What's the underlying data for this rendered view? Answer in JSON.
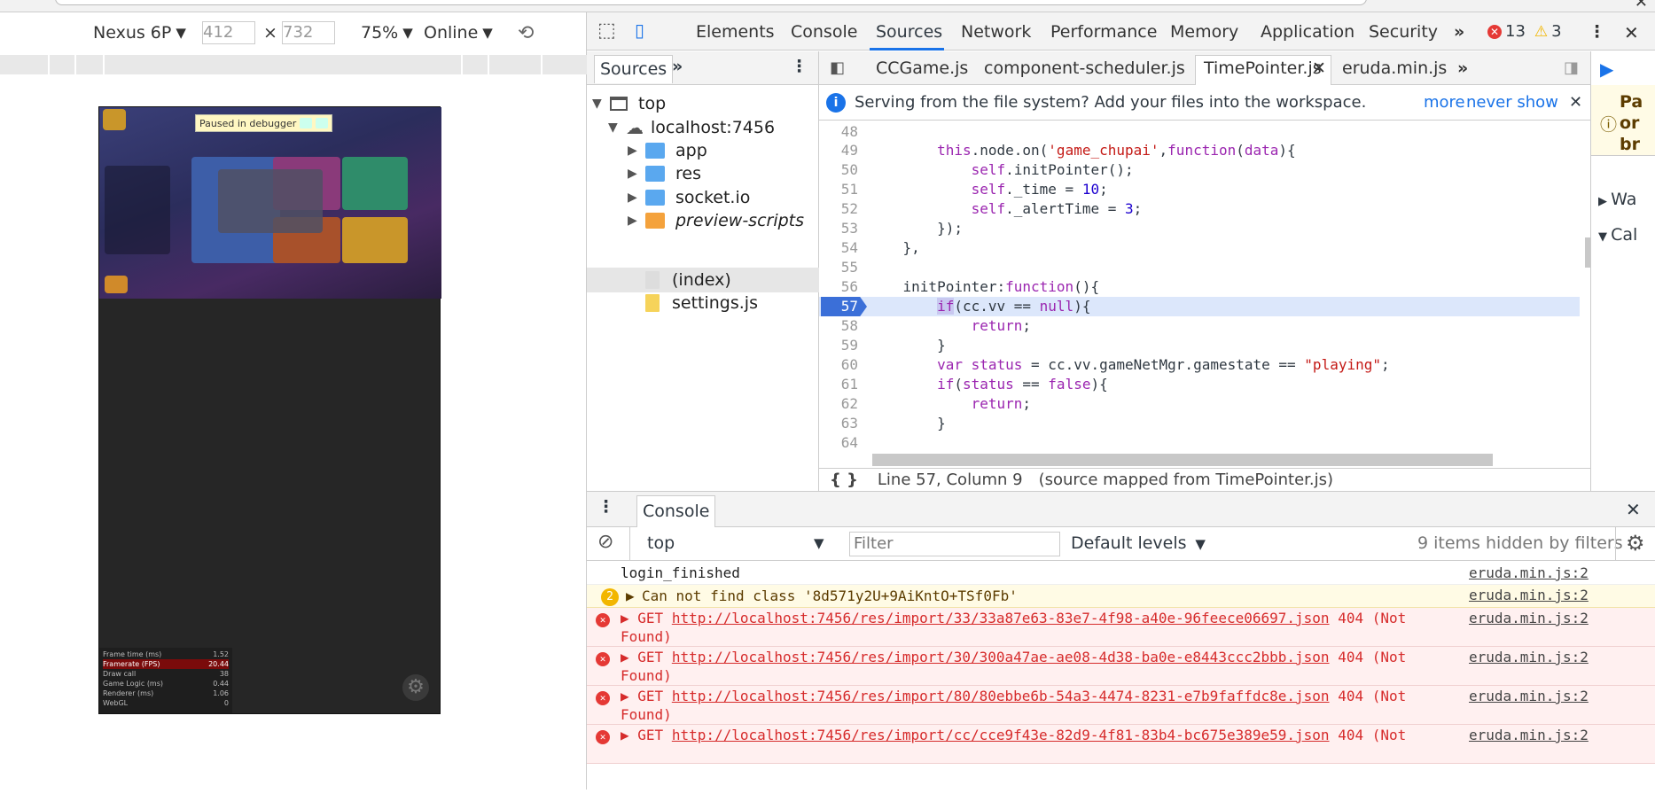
{
  "device_toolbar": {
    "device": "Nexus 6P",
    "width": "412",
    "height": "732",
    "times": "×",
    "zoom": "75%",
    "network": "Online"
  },
  "game": {
    "paused_label": "Paused in debugger",
    "perf": [
      {
        "label": "Frame time (ms)",
        "value": "1.52"
      },
      {
        "label": "Framerate (FPS)",
        "value": "20.44"
      },
      {
        "label": "Draw call",
        "value": "38"
      },
      {
        "label": "Game Logic (ms)",
        "value": "0.44"
      },
      {
        "label": "Renderer (ms)",
        "value": "1.06"
      },
      {
        "label": "WebGL",
        "value": "0"
      }
    ]
  },
  "tabs": [
    "Elements",
    "Console",
    "Sources",
    "Network",
    "Performance",
    "Memory",
    "Application",
    "Security"
  ],
  "errors": {
    "error_count": "13",
    "warning_count": "3"
  },
  "sidebar": {
    "tab": "Sources",
    "tree": {
      "top": "top",
      "host": "localhost:7456",
      "folders": [
        "app",
        "res",
        "socket.io",
        "preview-scripts"
      ],
      "files": [
        "(index)",
        "settings.js"
      ]
    }
  },
  "editor": {
    "tabs": [
      "CCGame.js",
      "component-scheduler.js",
      "TimePointer.js",
      "eruda.min.js"
    ],
    "infobar": {
      "text": "Serving from the file system? Add your files into the workspace.",
      "more": "more",
      "never": "never show"
    },
    "status": {
      "position": "Line 57, Column 9",
      "mapped": "(source mapped from TimePointer.js)"
    }
  },
  "code": {
    "l48": "48",
    "l49": "49",
    "l50": "50",
    "l51": "51",
    "l52": "52",
    "l53": "53",
    "l54": "54",
    "l55": "55",
    "l56": "56",
    "l57": "57",
    "l58": "58",
    "l59": "59",
    "l60": "60",
    "l61": "61",
    "l62": "62",
    "l63": "63",
    "l64": "64"
  },
  "console": {
    "tab": "Console",
    "context": "top",
    "filter_placeholder": "Filter",
    "levels": "Default levels",
    "hidden": "9 items hidden by filters",
    "messages": [
      {
        "text": "login_finished",
        "source": "eruda.min.js:2"
      },
      {
        "count": "2",
        "text": "Can not find class '8d571y2U+9AiKntO+TSf0Fb'",
        "source": "eruda.min.js:2"
      },
      {
        "method": "GET",
        "url": "http://localhost:7456/res/import/33/33a87e63-83e7-4f98-a40e-96feece06697.json",
        "status": "404 (Not",
        "status2": "Found)",
        "source": "eruda.min.js:2"
      },
      {
        "method": "GET",
        "url": "http://localhost:7456/res/import/30/300a47ae-ae08-4d38-ba0e-e8443ccc2bbb.json",
        "status": "404 (Not",
        "status2": "Found)",
        "source": "eruda.min.js:2"
      },
      {
        "method": "GET",
        "url": "http://localhost:7456/res/import/80/80ebbe6b-54a3-4474-8231-e7b9faffdc8e.json",
        "status": "404 (Not",
        "status2": "Found)",
        "source": "eruda.min.js:2"
      },
      {
        "method": "GET",
        "url": "http://localhost:7456/res/import/cc/cce9f43e-82d9-4f81-83b4-bc675e389e59.json",
        "status": "404 (Not",
        "source": "eruda.min.js:2"
      }
    ]
  },
  "right_pane": {
    "line1": "Pa",
    "line2": "or",
    "line3": "br",
    "w": "Wa",
    "c": "Cal"
  },
  "colors": {
    "accent": "#1a73e8",
    "error": "#e53935",
    "warning": "#f2b600",
    "exec_line": "#dce7fb"
  }
}
